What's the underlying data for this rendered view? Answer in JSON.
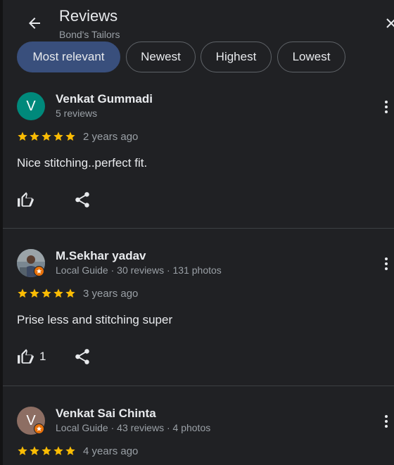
{
  "header": {
    "title": "Reviews",
    "subtitle": "Bond's Tailors"
  },
  "sort_chips": [
    {
      "label": "Most relevant",
      "selected": true
    },
    {
      "label": "Newest",
      "selected": false
    },
    {
      "label": "Highest",
      "selected": false
    },
    {
      "label": "Lowest",
      "selected": false
    }
  ],
  "reviews": [
    {
      "name": "Venkat Gummadi",
      "meta": "5 reviews",
      "avatar_letter": "V",
      "avatar_color": "#00897b",
      "local_guide": false,
      "rating": 5,
      "date": "2 years ago",
      "text": "Nice stitching..perfect fit.",
      "likes": ""
    },
    {
      "name": "M.Sekhar yadav",
      "meta": "Local Guide · 30 reviews · 131 photos",
      "avatar_letter": "",
      "avatar_color": "#6d7b86",
      "local_guide": true,
      "rating": 5,
      "date": "3 years ago",
      "text": "Prise less and stitching super",
      "likes": "1"
    },
    {
      "name": "Venkat Sai Chinta",
      "meta": "Local Guide · 43 reviews · 4 photos",
      "avatar_letter": "V",
      "avatar_color": "#8d6e63",
      "local_guide": true,
      "rating": 5,
      "date": "4 years ago",
      "text": "",
      "likes": ""
    }
  ],
  "colors": {
    "background": "#202124",
    "star": "#fbbc04",
    "chip_selected": "#394f7c",
    "local_guide_badge": "#e8710a"
  }
}
